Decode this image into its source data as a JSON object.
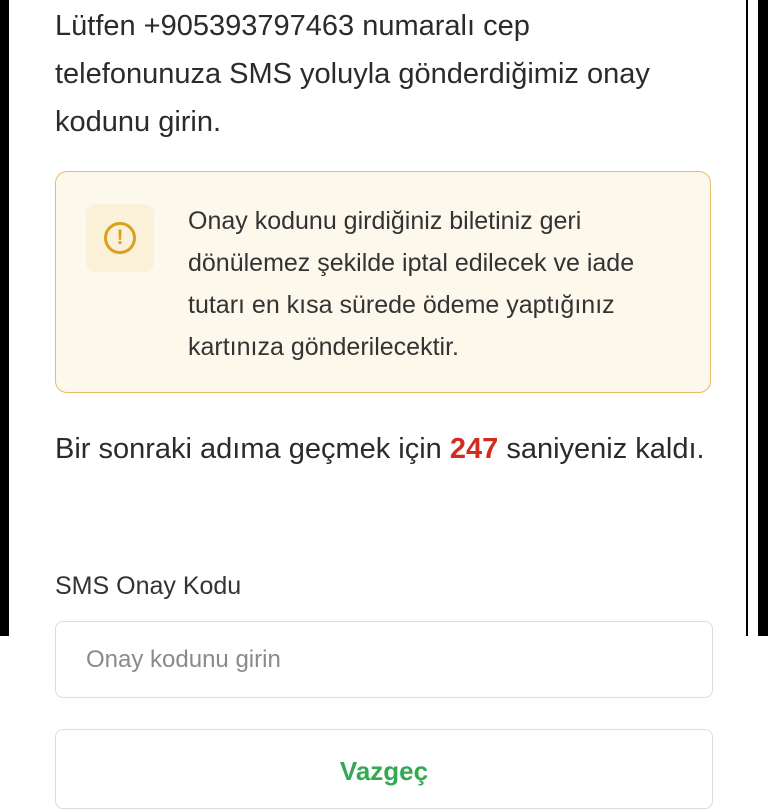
{
  "intro": {
    "text": "Lütfen +905393797463 numaralı cep telefonunuza SMS yoluyla gönderdiğimiz onay kodunu girin."
  },
  "warning": {
    "icon": "exclamation-circle-icon",
    "icon_glyph": "!",
    "text": "Onay kodunu girdiğiniz biletiniz geri dönülemez şekilde iptal edilecek ve iade tutarı en kısa sürede ödeme yaptığınız kartınıza gönderilecektir.",
    "accent_color": "#d9a21d",
    "background_color": "#fdf8ec"
  },
  "countdown": {
    "prefix": "Bir sonraki adıma geçmek için",
    "seconds": "247",
    "suffix": "saniyeniz kaldı.",
    "highlight_color": "#d52b1e"
  },
  "sms_field": {
    "label": "SMS Onay Kodu",
    "value": "",
    "placeholder": "Onay kodunu girin"
  },
  "submit": {
    "label": "Vazgeç",
    "color": "#34a853"
  }
}
